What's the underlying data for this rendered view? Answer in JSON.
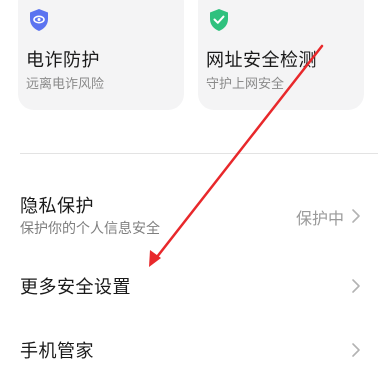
{
  "cards": [
    {
      "title": "电诈防护",
      "subtitle": "远离电诈风险",
      "icon": "shield-eye-icon",
      "icon_color": "#5b73f0"
    },
    {
      "title": "网址安全检测",
      "subtitle": "守护上网安全",
      "icon": "shield-check-icon",
      "icon_color": "#2fc17e"
    }
  ],
  "rows": [
    {
      "label": "隐私保护",
      "description": "保护你的个人信息安全",
      "value": "保护中"
    },
    {
      "label": "更多安全设置"
    },
    {
      "label": "手机管家"
    }
  ],
  "annotation_color": "#e8282b"
}
